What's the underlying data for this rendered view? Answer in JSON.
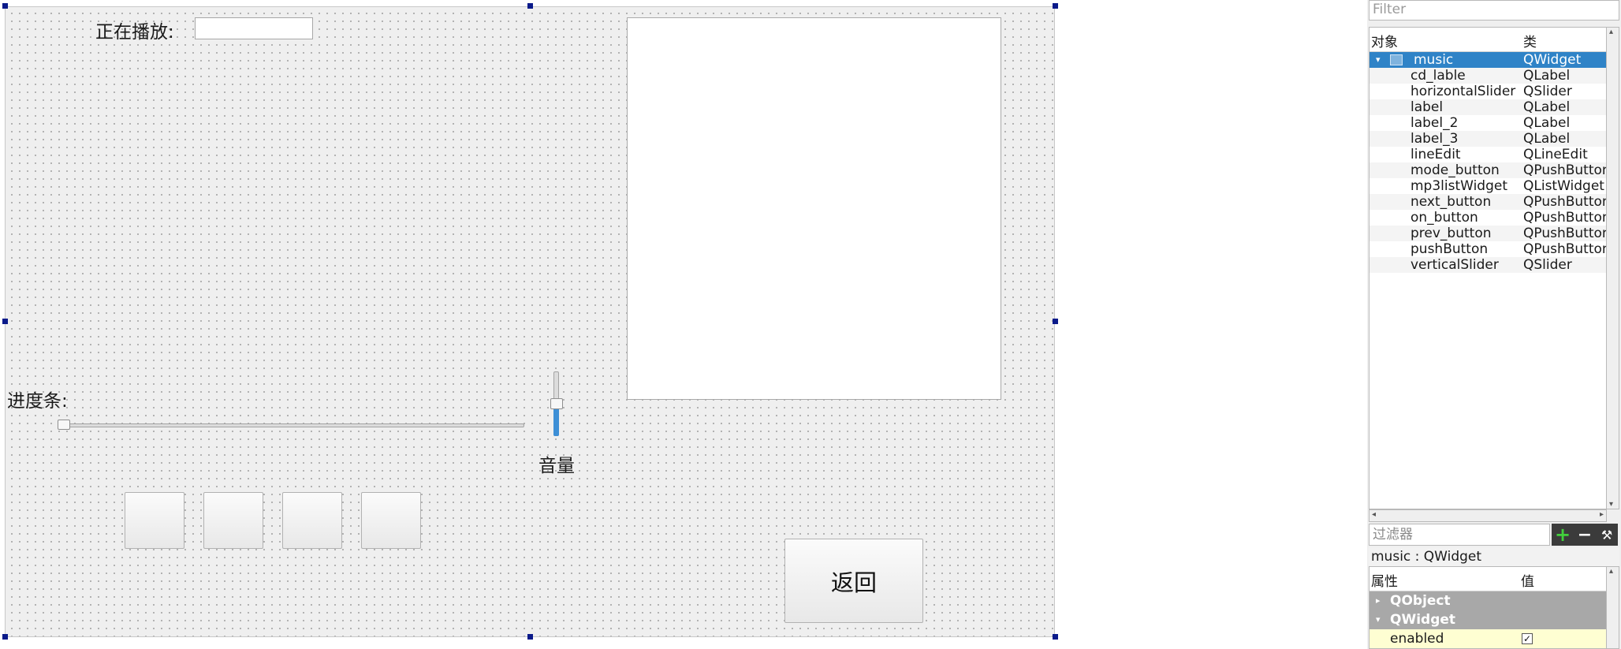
{
  "form": {
    "now_playing_label": "正在播放:",
    "progress_label": "进度条:",
    "volume_label": "音量",
    "back_button": "返回",
    "progress_fraction": 0.0,
    "volume_fraction": 0.5
  },
  "object_inspector": {
    "filter_placeholder": "Filter",
    "col_object": "对象",
    "col_class": "类",
    "root": {
      "name": "music",
      "class": "QWidget"
    },
    "children": [
      {
        "name": "cd_lable",
        "class": "QLabel"
      },
      {
        "name": "horizontalSlider",
        "class": "QSlider"
      },
      {
        "name": "label",
        "class": "QLabel"
      },
      {
        "name": "label_2",
        "class": "QLabel"
      },
      {
        "name": "label_3",
        "class": "QLabel"
      },
      {
        "name": "lineEdit",
        "class": "QLineEdit"
      },
      {
        "name": "mode_button",
        "class": "QPushButton"
      },
      {
        "name": "mp3listWidget",
        "class": "QListWidget"
      },
      {
        "name": "next_button",
        "class": "QPushButton"
      },
      {
        "name": "on_button",
        "class": "QPushButton"
      },
      {
        "name": "prev_button",
        "class": "QPushButton"
      },
      {
        "name": "pushButton",
        "class": "QPushButton"
      },
      {
        "name": "verticalSlider",
        "class": "QSlider"
      }
    ]
  },
  "property_editor": {
    "filter_placeholder": "过滤器",
    "title": "music : QWidget",
    "col_property": "属性",
    "col_value": "值",
    "groups": [
      "QObject",
      "QWidget"
    ],
    "first_property": "enabled",
    "enabled_checked": "✓"
  }
}
